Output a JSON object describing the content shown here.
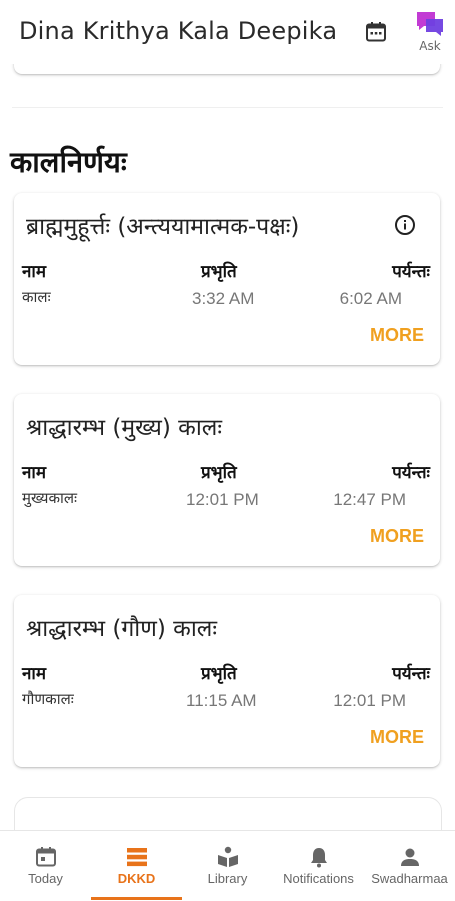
{
  "app": {
    "title": "Dina Krithya Kala Deepika",
    "ask_label": "Ask"
  },
  "section": {
    "title": "कालनिर्णयः"
  },
  "labels": {
    "name": "नाम",
    "start": "प्रभृति",
    "end": "पर्यन्तः",
    "more": "MORE"
  },
  "cards": [
    {
      "title": "ब्राह्ममुहूर्त्तः (अन्त्ययामात्मक-पक्षः)",
      "name": "कालः",
      "start": "3:32 AM",
      "end": "6:02 AM",
      "has_info": true
    },
    {
      "title": "श्राद्धारम्भ (मुख्य) कालः",
      "name": "मुख्यकालः",
      "start": "12:01 PM",
      "end": "12:47 PM",
      "has_info": false
    },
    {
      "title": "श्राद्धारम्भ (गौण) कालः",
      "name": "गौणकालः",
      "start": "11:15 AM",
      "end": "12:01 PM",
      "has_info": false
    }
  ],
  "nav": [
    {
      "label": "Today",
      "icon": "calendar-today-icon",
      "active": false
    },
    {
      "label": "DKKD",
      "icon": "list-icon",
      "active": true
    },
    {
      "label": "Library",
      "icon": "book-reader-icon",
      "active": false
    },
    {
      "label": "Notifications",
      "icon": "bell-icon",
      "active": false
    },
    {
      "label": "Swadharmaa",
      "icon": "person-icon",
      "active": false
    }
  ],
  "colors": {
    "accent": "#e8731a",
    "more": "#f0a020",
    "ask_icon": "#8b3fd6"
  }
}
